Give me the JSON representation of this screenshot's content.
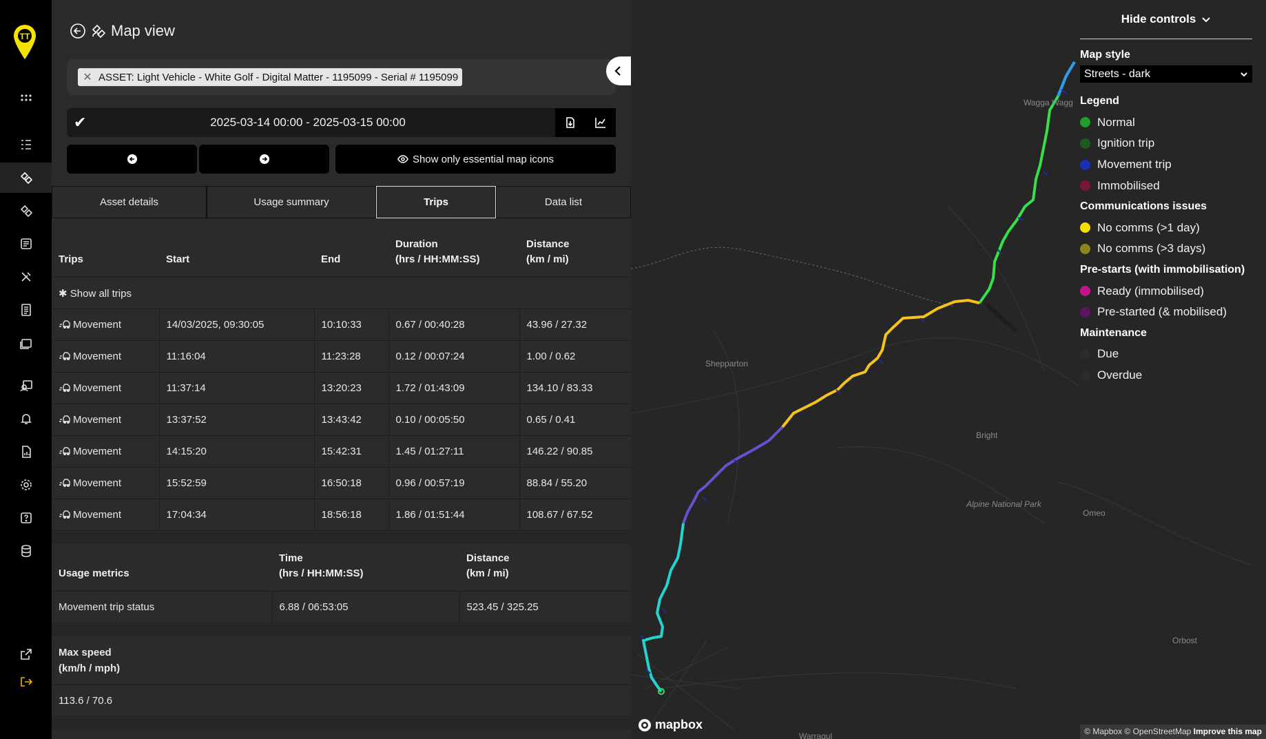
{
  "header": {
    "title": "Map view",
    "back_icon": "arrow-left-circle-icon",
    "map_icon": "satellite-icon"
  },
  "asset_filter": {
    "chip_label": "ASSET: Light Vehicle - White Golf - Digital Matter - 1195099 - Serial # 1195099"
  },
  "date_range": {
    "value": "2025-03-14 00:00 - 2025-03-15 00:00"
  },
  "toolbar": {
    "essential_icons_label": "Show only essential map icons"
  },
  "tabs": [
    {
      "label": "Asset details"
    },
    {
      "label": "Usage summary"
    },
    {
      "label": "Trips"
    },
    {
      "label": "Data list"
    }
  ],
  "trips_table": {
    "headers": {
      "trips": "Trips",
      "start": "Start",
      "end": "End",
      "duration_1": "Duration",
      "duration_2": "(hrs / HH:MM:SS)",
      "distance_1": "Distance",
      "distance_2": "(km / mi)"
    },
    "show_all": "Show all trips",
    "rows": [
      {
        "type": "Movement",
        "start": "14/03/2025, 09:30:05",
        "end": "10:10:33",
        "duration": "0.67 / 00:40:28",
        "distance": "43.96 / 27.32"
      },
      {
        "type": "Movement",
        "start": "11:16:04",
        "end": "11:23:28",
        "duration": "0.12 / 00:07:24",
        "distance": "1.00 / 0.62"
      },
      {
        "type": "Movement",
        "start": "11:37:14",
        "end": "13:20:23",
        "duration": "1.72 / 01:43:09",
        "distance": "134.10 / 83.33"
      },
      {
        "type": "Movement",
        "start": "13:37:52",
        "end": "13:43:42",
        "duration": "0.10 / 00:05:50",
        "distance": "0.65 / 0.41"
      },
      {
        "type": "Movement",
        "start": "14:15:20",
        "end": "15:42:31",
        "duration": "1.45 / 01:27:11",
        "distance": "146.22 / 90.85"
      },
      {
        "type": "Movement",
        "start": "15:52:59",
        "end": "16:50:18",
        "duration": "0.96 / 00:57:19",
        "distance": "88.84 / 55.20"
      },
      {
        "type": "Movement",
        "start": "17:04:34",
        "end": "18:56:18",
        "duration": "1.86 / 01:51:44",
        "distance": "108.67 / 67.52"
      }
    ]
  },
  "usage_metrics": {
    "headers": {
      "metric": "Usage metrics",
      "time_1": "Time",
      "time_2": "(hrs / HH:MM:SS)",
      "distance_1": "Distance",
      "distance_2": "(km / mi)"
    },
    "row": {
      "label": "Movement trip status",
      "time": "6.88 / 06:53:05",
      "distance": "523.45 / 325.25"
    }
  },
  "max_speed": {
    "label_1": "Max speed",
    "label_2": "(km/h / mph)",
    "value": "113.6 / 70.6"
  },
  "map": {
    "hide_controls": "Hide controls",
    "map_style_label": "Map style",
    "map_style_value": "Streets - dark",
    "legend_title": "Legend",
    "legend": [
      {
        "label": "Normal",
        "color": "#1f9e2e"
      },
      {
        "label": "Ignition trip",
        "color": "#1f5a22"
      },
      {
        "label": "Movement trip",
        "color": "#1c2fb0"
      }
    ],
    "legend_immobilised": {
      "label": "Immobilised",
      "color": "#7a1634"
    },
    "comms_title": "Communications issues",
    "comms": [
      {
        "label": "No comms (>1 day)",
        "color": "#f3e000"
      },
      {
        "label": "No comms (>3 days)",
        "color": "#8c8420"
      }
    ],
    "prestart_title": "Pre-starts (with immobilisation)",
    "prestart": [
      {
        "label": "Ready (immobilised)",
        "color": "#c0168a"
      },
      {
        "label": "Pre-started (& mobilised)",
        "color": "#5a1660"
      }
    ],
    "maintenance_title": "Maintenance",
    "maintenance": [
      {
        "label": "Due",
        "color": "#2c2c2c"
      },
      {
        "label": "Overdue",
        "color": "#2c2c2c"
      }
    ],
    "places": {
      "wagga": "Wagga Wagg",
      "shepparton": "Shepparton",
      "bright": "Bright",
      "alpine": "Alpine National Park",
      "omeo": "Omeo",
      "orbost": "Orbost",
      "warragul": "Warragul"
    },
    "mapbox_logo": "mapbox",
    "attribution": "© Mapbox © OpenStreetMap",
    "improve_link": "Improve this map"
  }
}
